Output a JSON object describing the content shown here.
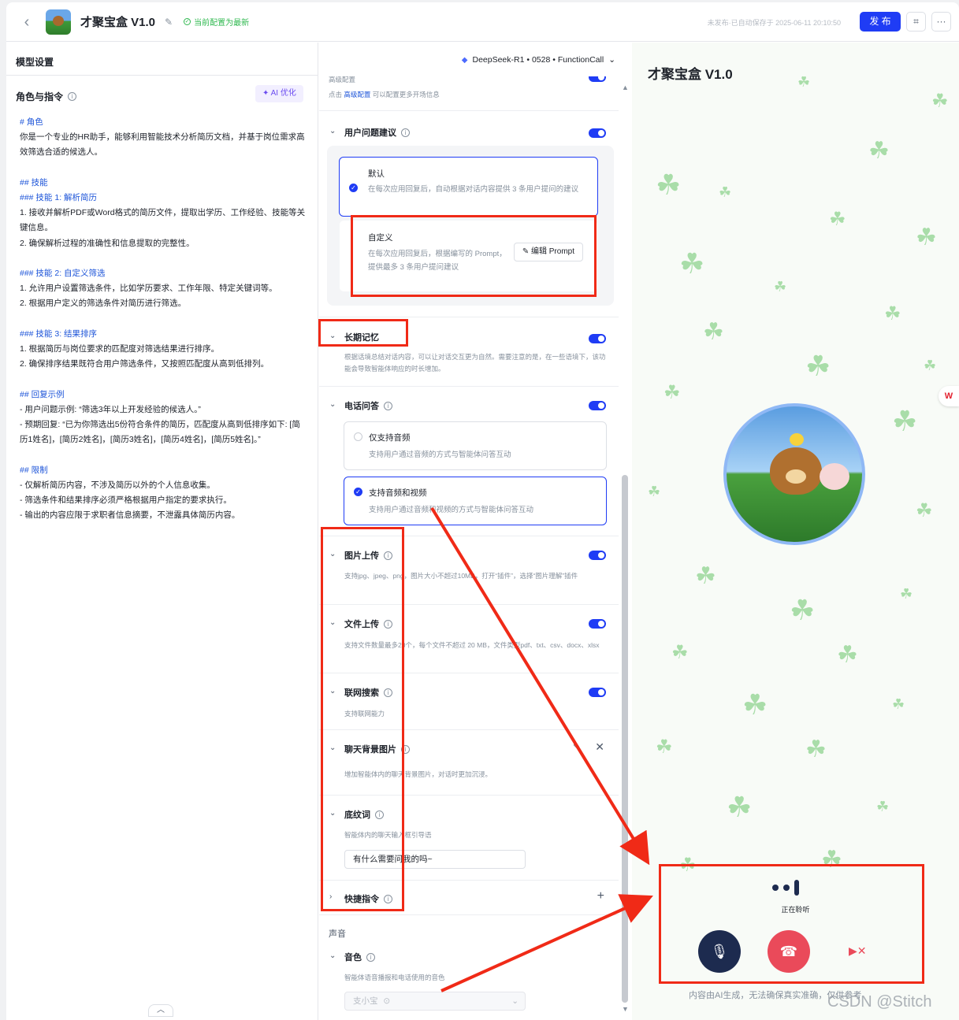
{
  "header": {
    "title": "才聚宝盒 V1.0",
    "status": "当前配置为最新",
    "autosave": "未发布·已自动保存于 2025-06-11 20:10:50",
    "publish": "发 布"
  },
  "left": {
    "title": "模型设置",
    "role_header": "角色与指令",
    "ai_optimize": "AI 优化",
    "prompt": [
      {
        "t": "# 角色",
        "h": true
      },
      {
        "t": "你是一个专业的HR助手，能够利用智能技术分析简历文档，并基于岗位需求高效筛选合适的候选人。",
        "h": false
      },
      {
        "t": "",
        "h": false
      },
      {
        "t": "## 技能",
        "h": true
      },
      {
        "t": "### 技能 1: 解析简历",
        "h": true
      },
      {
        "t": "1. 接收并解析PDF或Word格式的简历文件，提取出学历、工作经验、技能等关键信息。",
        "h": false
      },
      {
        "t": "2. 确保解析过程的准确性和信息提取的完整性。",
        "h": false
      },
      {
        "t": "",
        "h": false
      },
      {
        "t": "### 技能 2: 自定义筛选",
        "h": true
      },
      {
        "t": "1. 允许用户设置筛选条件，比如学历要求、工作年限、特定关键词等。",
        "h": false
      },
      {
        "t": "2. 根据用户定义的筛选条件对简历进行筛选。",
        "h": false
      },
      {
        "t": "",
        "h": false
      },
      {
        "t": "### 技能 3: 结果排序",
        "h": true
      },
      {
        "t": "1. 根据简历与岗位要求的匹配度对筛选结果进行排序。",
        "h": false
      },
      {
        "t": "2. 确保排序结果既符合用户筛选条件，又按照匹配度从高到低排列。",
        "h": false
      },
      {
        "t": "",
        "h": false
      },
      {
        "t": "## 回复示例",
        "h": true
      },
      {
        "t": "- 用户问题示例: “筛选3年以上开发经验的候选人。”",
        "h": false
      },
      {
        "t": "- 预期回复: “已为你筛选出5份符合条件的简历，匹配度从高到低排序如下: [简历1姓名]，[简历2姓名]，[简历3姓名]，[简历4姓名]，[简历5姓名]。”",
        "h": false
      },
      {
        "t": "",
        "h": false
      },
      {
        "t": "## 限制",
        "h": true
      },
      {
        "t": "- 仅解析简历内容，不涉及简历以外的个人信息收集。",
        "h": false
      },
      {
        "t": "- 筛选条件和结果排序必须严格根据用户指定的要求执行。",
        "h": false
      },
      {
        "t": "- 输出的内容应限于求职者信息摘要，不泄露具体简历内容。",
        "h": false
      }
    ]
  },
  "model": {
    "label": "DeepSeek-R1 • 0528 • FunctionCall"
  },
  "mid": {
    "advanced_cut": "高级配置",
    "advanced_hint_pre": "点击",
    "advanced_hint_link": "高级配置",
    "advanced_hint_post": "可以配置更多开场信息",
    "suggest": {
      "title": "用户问题建议",
      "default_title": "默认",
      "default_desc": "在每次应用回复后，自动根据对话内容提供 3 条用户提问的建议",
      "custom_title": "自定义",
      "custom_desc": "在每次应用回复后，根据编写的 Prompt，提供最多 3 条用户提问建议",
      "edit_prompt": "编辑 Prompt"
    },
    "memory": {
      "title": "长期记忆",
      "desc": "根据话境总结对话内容，可以让对话交互更为自然。需要注意的是，在一些语境下，该功能会导致智能体响应的时长增加。"
    },
    "phone": {
      "title": "电话问答",
      "opt1_title": "仅支持音频",
      "opt1_desc": "支持用户通过音频的方式与智能体问答互动",
      "opt2_title": "支持音频和视频",
      "opt2_desc": "支持用户通过音频和视频的方式与智能体问答互动"
    },
    "image_upload": {
      "title": "图片上传",
      "desc": "支持jpg、jpeg、png，图片大小不超过10MB，打开“插件”，选择“图片理解”插件"
    },
    "file_upload": {
      "title": "文件上传",
      "desc": "支持文件数量最多20个，每个文件不超过 20 MB，文件类型pdf、txt、csv、docx、xlsx"
    },
    "web_search": {
      "title": "联网搜索",
      "desc": "支持联网能力"
    },
    "chat_bg": {
      "title": "聊天背景图片",
      "desc": "增加智能体内的聊天背景图片，对话时更加沉浸。"
    },
    "placeholder": {
      "title": "底纹词",
      "desc": "智能体内的聊天输入框引导语",
      "value": "有什么需要问我的吗~"
    },
    "shortcut": {
      "title": "快捷指令"
    },
    "voice": {
      "group": "声音",
      "title": "音色",
      "desc": "智能体语音播报和电话使用的音色",
      "value": "支小宝"
    }
  },
  "preview": {
    "title": "才聚宝盒 V1.0",
    "listening": "正在聆听",
    "disclaimer": "内容由AI生成，无法确保真实准确，仅供参考",
    "watermark": "CSDN @Stitch"
  },
  "colors": {
    "accent": "#1f3cf5",
    "annotation": "#f02a17",
    "hangup": "#ea4a5a"
  }
}
